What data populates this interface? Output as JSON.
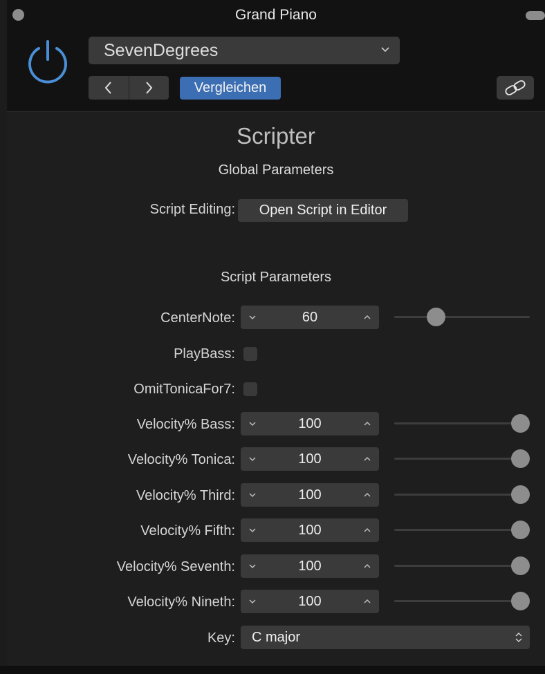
{
  "window": {
    "title": "Grand Piano"
  },
  "header": {
    "preset_name": "SevenDegrees",
    "compare_label": "Vergleichen"
  },
  "plugin": {
    "name": "Scripter",
    "global_heading": "Global Parameters",
    "script_editing_label": "Script Editing:",
    "open_editor_label": "Open Script in Editor",
    "params_heading": "Script Parameters"
  },
  "params": {
    "center_note": {
      "label": "CenterNote:",
      "value": "60",
      "slider_fraction": 0.28
    },
    "play_bass": {
      "label": "PlayBass:",
      "checked": false
    },
    "omit_tonica": {
      "label": "OmitTonicaFor7:",
      "checked": false
    },
    "vel_bass": {
      "label": "Velocity% Bass:",
      "value": "100",
      "slider_fraction": 1.0
    },
    "vel_tonica": {
      "label": "Velocity% Tonica:",
      "value": "100",
      "slider_fraction": 1.0
    },
    "vel_third": {
      "label": "Velocity% Third:",
      "value": "100",
      "slider_fraction": 1.0
    },
    "vel_fifth": {
      "label": "Velocity% Fifth:",
      "value": "100",
      "slider_fraction": 1.0
    },
    "vel_seventh": {
      "label": "Velocity% Seventh:",
      "value": "100",
      "slider_fraction": 1.0
    },
    "vel_nineth": {
      "label": "Velocity% Nineth:",
      "value": "100",
      "slider_fraction": 1.0
    },
    "key": {
      "label": "Key:",
      "value": "C major"
    }
  },
  "colors": {
    "accent_blue": "#3c6eb4",
    "power_icon": "#4a8fd6",
    "background": "#1e1e1e",
    "header_background": "#121212"
  },
  "icons": {
    "power": "power-icon",
    "preset_dropdown": "chevron-down-icon",
    "prev": "chevron-left-icon",
    "next": "chevron-right-icon",
    "link": "link-icon",
    "stepper_down": "chevron-down-icon",
    "stepper_up": "chevron-up-icon",
    "key_select": "up-down-arrows-icon"
  }
}
